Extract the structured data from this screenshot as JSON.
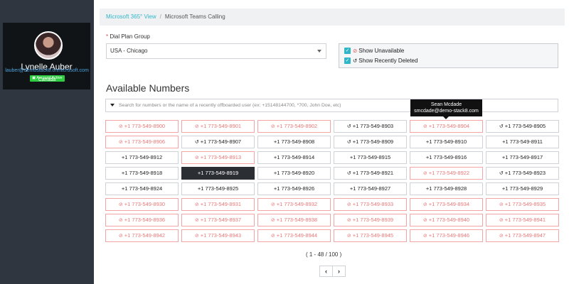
{
  "sidebar": {
    "profile": {
      "name": "Lynelle Auber",
      "badge": "Account Active",
      "email": "lauber@demostack8.onmicrosoft.com",
      "country": "Canada"
    }
  },
  "breadcrumb": {
    "home": "Microsoft 365° View",
    "separator": "/",
    "current": "Microsoft Teams Calling"
  },
  "dial_plan": {
    "required_mark": "*",
    "label": "Dial Plan Group",
    "value": "USA - Chicago"
  },
  "filters": [
    {
      "label": "Show Unavailable",
      "checked": true,
      "icon": "ban-icon"
    },
    {
      "label": "Show Recently Deleted",
      "checked": true,
      "icon": "history-icon"
    }
  ],
  "heading": "Available Numbers",
  "search": {
    "placeholder": "Search for numbers or the name of a recently offboarded user (ex: +15148144700, *700, John Doe, etc)"
  },
  "tooltip": {
    "name": "Sean Mcdade",
    "email": "smcdade@demo-stack8.com"
  },
  "numbers": [
    {
      "n": "+1 773-549-8900",
      "s": "unavailable"
    },
    {
      "n": "+1 773-549-8901",
      "s": "unavailable"
    },
    {
      "n": "+1 773-549-8902",
      "s": "unavailable"
    },
    {
      "n": "+1 773-549-8903",
      "s": "deleted"
    },
    {
      "n": "+1 773-549-8904",
      "s": "unavailable"
    },
    {
      "n": "+1 773-549-8905",
      "s": "deleted"
    },
    {
      "n": "+1 773-549-8906",
      "s": "unavailable"
    },
    {
      "n": "+1 773-549-8907",
      "s": "deleted"
    },
    {
      "n": "+1 773-549-8908",
      "s": "available"
    },
    {
      "n": "+1 773-549-8909",
      "s": "deleted"
    },
    {
      "n": "+1 773-549-8910",
      "s": "available"
    },
    {
      "n": "+1 773-549-8911",
      "s": "available"
    },
    {
      "n": "+1 773-549-8912",
      "s": "available"
    },
    {
      "n": "+1 773-549-8913",
      "s": "unavailable"
    },
    {
      "n": "+1 773-549-8914",
      "s": "available"
    },
    {
      "n": "+1 773-549-8915",
      "s": "available"
    },
    {
      "n": "+1 773-549-8916",
      "s": "available"
    },
    {
      "n": "+1 773-549-8917",
      "s": "available"
    },
    {
      "n": "+1 773-549-8918",
      "s": "available"
    },
    {
      "n": "+1 773-549-8919",
      "s": "selected"
    },
    {
      "n": "+1 773-549-8920",
      "s": "available"
    },
    {
      "n": "+1 773-549-8921",
      "s": "deleted"
    },
    {
      "n": "+1 773-549-8922",
      "s": "unavailable"
    },
    {
      "n": "+1 773-549-8923",
      "s": "deleted"
    },
    {
      "n": "+1 773-549-8924",
      "s": "available"
    },
    {
      "n": "+1 773-549-8925",
      "s": "available"
    },
    {
      "n": "+1 773-549-8926",
      "s": "available"
    },
    {
      "n": "+1 773-549-8927",
      "s": "available"
    },
    {
      "n": "+1 773-549-8928",
      "s": "available"
    },
    {
      "n": "+1 773-549-8929",
      "s": "available"
    },
    {
      "n": "+1 773-549-8930",
      "s": "unavailable"
    },
    {
      "n": "+1 773-549-8931",
      "s": "unavailable"
    },
    {
      "n": "+1 773-549-8932",
      "s": "unavailable"
    },
    {
      "n": "+1 773-549-8933",
      "s": "unavailable"
    },
    {
      "n": "+1 773-549-8934",
      "s": "unavailable"
    },
    {
      "n": "+1 773-549-8935",
      "s": "unavailable"
    },
    {
      "n": "+1 773-549-8936",
      "s": "unavailable"
    },
    {
      "n": "+1 773-549-8937",
      "s": "unavailable"
    },
    {
      "n": "+1 773-549-8938",
      "s": "unavailable"
    },
    {
      "n": "+1 773-549-8939",
      "s": "unavailable"
    },
    {
      "n": "+1 773-549-8940",
      "s": "unavailable"
    },
    {
      "n": "+1 773-549-8941",
      "s": "unavailable"
    },
    {
      "n": "+1 773-549-8942",
      "s": "unavailable"
    },
    {
      "n": "+1 773-549-8943",
      "s": "unavailable"
    },
    {
      "n": "+1 773-549-8944",
      "s": "unavailable"
    },
    {
      "n": "+1 773-549-8945",
      "s": "unavailable"
    },
    {
      "n": "+1 773-549-8946",
      "s": "unavailable"
    },
    {
      "n": "+1 773-549-8947",
      "s": "unavailable"
    }
  ],
  "pagination": {
    "info": "( 1 - 48 / 100 )",
    "prev": "‹",
    "next": "›"
  },
  "colors": {
    "accent": "#31b6c9",
    "sidebar": "#2f3640",
    "unavailable": "#e87777",
    "badge": "#2ecc40",
    "selected": "#2b2e33"
  }
}
